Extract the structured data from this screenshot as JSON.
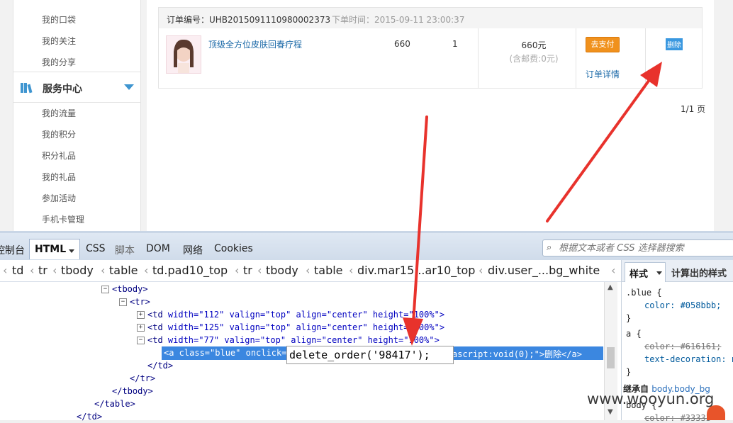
{
  "sidebar": {
    "items_top": [
      "我的口袋",
      "我的关注",
      "我的分享"
    ],
    "section_title": "服务中心",
    "items_bottom": [
      "我的流量",
      "我的积分",
      "积分礼品",
      "我的礼品",
      "参加活动",
      "手机卡管理"
    ]
  },
  "order": {
    "number_label": "订单编号：UHB2015091110980002373",
    "time_label": "下单时间：2015-09-11 23:00:37",
    "product_name": "顶级全方位皮肤回春疗程",
    "price": "660",
    "quantity": "1",
    "total": "660元",
    "postage": "(含邮费:0元)",
    "pay_button": "去支付",
    "detail_link": "订单详情",
    "delete_link": "删除"
  },
  "pager": "1/1 页",
  "devtools": {
    "tabs": [
      "控制台",
      "HTML",
      "CSS",
      "脚本",
      "DOM",
      "网络",
      "Cookies"
    ],
    "search_placeholder": "根据文本或者 CSS 选择器搜索",
    "breadcrumbs": [
      "td",
      "tr",
      "tbody",
      "table",
      "td.pad10_top",
      "tr",
      "tbody",
      "table",
      "div.mar15...ar10_top",
      "div.user_...bg_white"
    ],
    "tree": {
      "l1": "<tbody>",
      "l2": "<tr>",
      "l3_tag": "<td",
      "l3_attrs": " width=\"112\" valign=\"top\" align=\"center\" height=\"100%\">",
      "l4_tag": "<td",
      "l4_attrs": " width=\"125\" valign=\"top\" align=\"center\" height=\"100%\">",
      "l5_tag": "<td",
      "l5_attrs": " width=\"77\" valign=\"top\" align=\"center\" height=\"100%\">",
      "selected_start": "<a class=\"blue\" onclick=",
      "selected_end": "ascript:void(0);\">删除</a>",
      "l7": "</td>",
      "l8": "</tr>",
      "l9": "</tbody>",
      "l10": "</table>",
      "l11": "</td>"
    },
    "tooltip": "delete_order('98417');",
    "side": {
      "tab_style": "样式",
      "tab_computed": "计算出的样式",
      "rule1_selector": ".blue {",
      "rule1_prop": "color: #058bbb;",
      "rule2_selector": "a {",
      "rule2_prop1": "color: #616161;",
      "rule2_prop2": "text-decoration: n",
      "close": "}",
      "inherit_label": "继承自",
      "inherit_target": "body.body_bg",
      "rule3_selector": "body {",
      "rule3_prop": "color: #33333"
    }
  },
  "watermark": "www.wooyun.org",
  "colors": {
    "link": "#1c6aa8",
    "pay": "#f0911d",
    "selection": "#3b87e0",
    "arrow": "#e8322c"
  }
}
